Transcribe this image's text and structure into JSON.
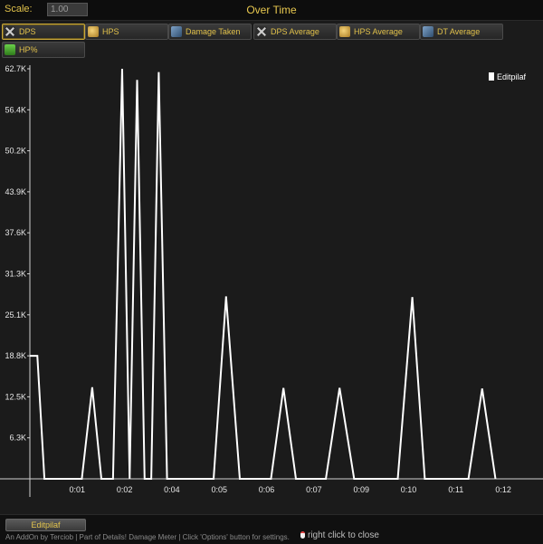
{
  "topbar": {
    "scale_label": "Scale:",
    "scale_value": "1.00",
    "title": "Over Time"
  },
  "tabs": [
    {
      "label": "DPS",
      "icon": "crossed-swords-icon",
      "active": true
    },
    {
      "label": "HPS",
      "icon": "healing-icon",
      "active": false
    },
    {
      "label": "Damage Taken",
      "icon": "armor-icon",
      "active": false
    },
    {
      "label": "DPS Average",
      "icon": "crossed-swords-icon",
      "active": false
    },
    {
      "label": "HPS Average",
      "icon": "healing-icon",
      "active": false
    },
    {
      "label": "DT Average",
      "icon": "armor-icon",
      "active": false
    },
    {
      "label": "HP%",
      "icon": "health-potion-icon",
      "active": false
    }
  ],
  "chart_data": {
    "type": "line",
    "y_ticks": [
      "62.7K",
      "56.4K",
      "50.2K",
      "43.9K",
      "37.6K",
      "31.3K",
      "25.1K",
      "18.8K",
      "12.5K",
      "6.3K"
    ],
    "x_ticks": [
      "0:01",
      "0:02",
      "0:04",
      "0:05",
      "0:06",
      "0:07",
      "0:09",
      "0:10",
      "0:11",
      "0:12"
    ],
    "ylim": [
      0,
      62700
    ],
    "xlim": [
      0,
      12.3
    ],
    "grid": false,
    "legend_position": "top-right",
    "series": [
      {
        "name": "Editpilaf",
        "color": "#ffffff",
        "x": [
          0,
          0.18,
          0.35,
          1.25,
          1.5,
          1.72,
          2.0,
          2.22,
          2.4,
          2.58,
          2.76,
          2.92,
          3.1,
          3.3,
          3.55,
          4.42,
          4.72,
          5.05,
          5.8,
          6.1,
          6.4,
          7.12,
          7.45,
          7.8,
          8.85,
          9.2,
          9.5,
          10.55,
          10.88,
          11.2
        ],
        "y": [
          18800,
          18800,
          0,
          0,
          14000,
          0,
          0,
          62700,
          0,
          61000,
          0,
          0,
          62200,
          0,
          0,
          0,
          27900,
          0,
          0,
          13900,
          0,
          0,
          13900,
          0,
          0,
          27800,
          0,
          0,
          13800,
          0
        ]
      }
    ]
  },
  "legend": {
    "label": "Editpilaf",
    "color": "#ffffff"
  },
  "footer": {
    "actor_button": "Editpilaf",
    "credit": "An AddOn by Terciob | Part of Details! Damage Meter | Click 'Options' button for settings.",
    "close_hint": "right click to close"
  }
}
